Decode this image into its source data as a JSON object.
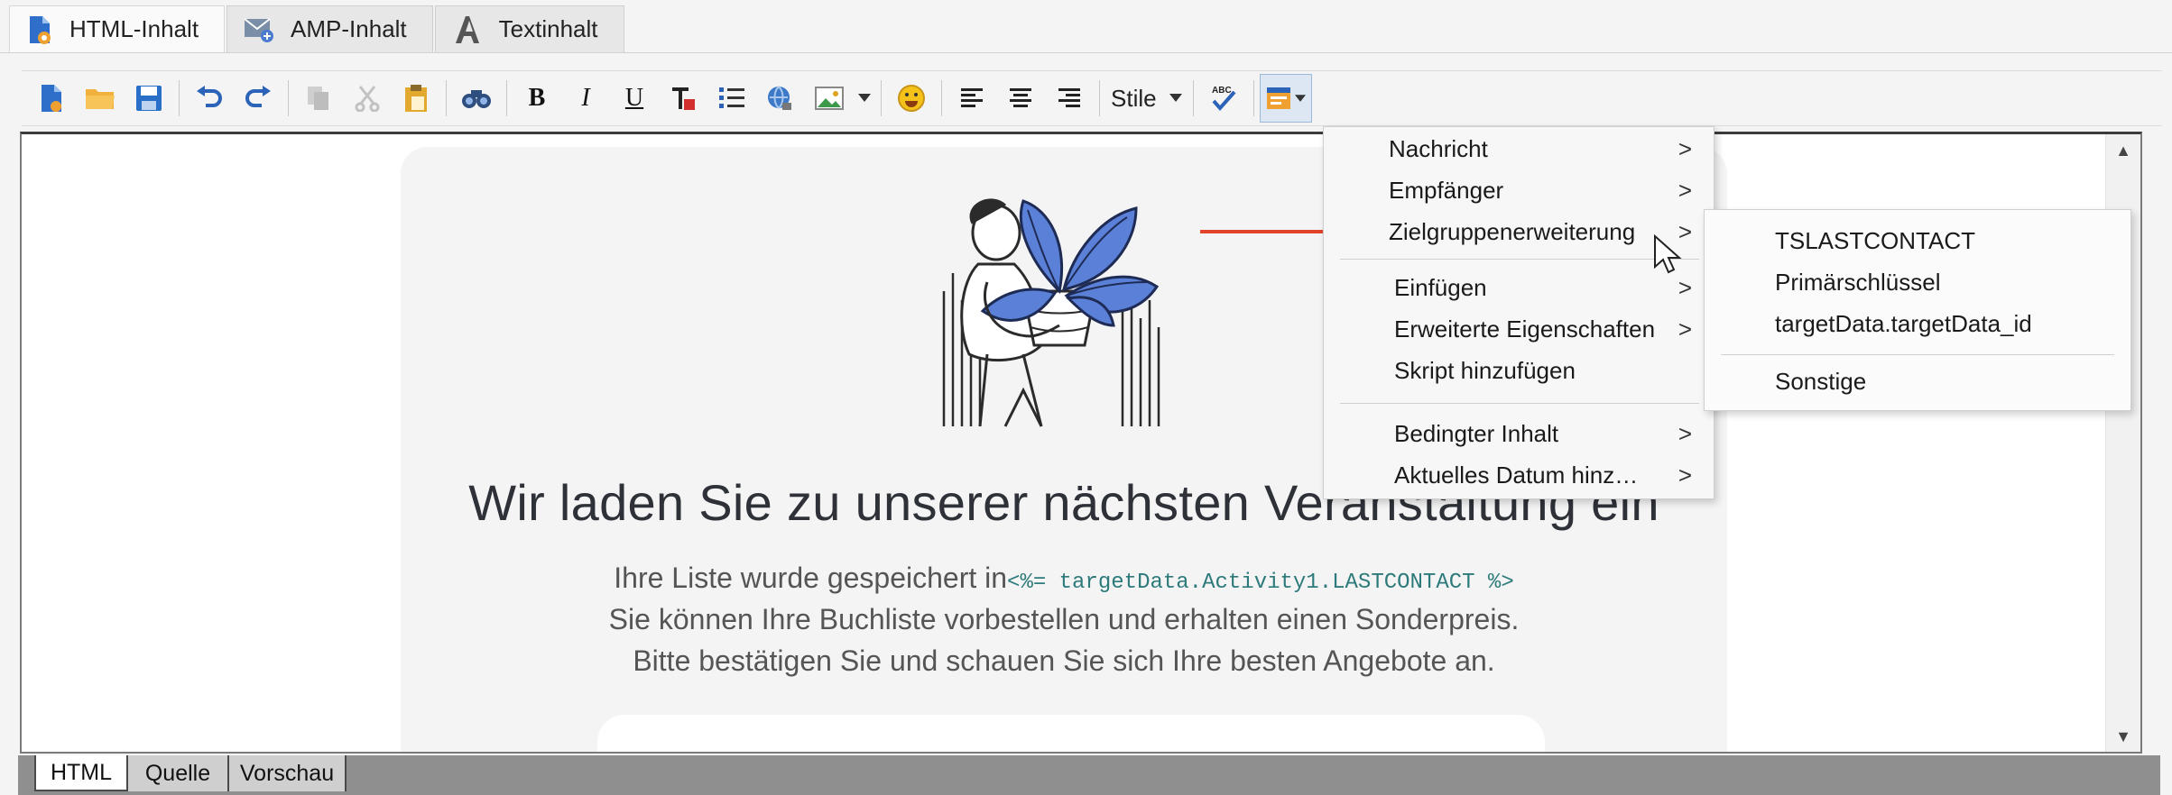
{
  "tabs": [
    {
      "label": "HTML-Inhalt",
      "icon": "html-content-icon",
      "active": true
    },
    {
      "label": "AMP-Inhalt",
      "icon": "amp-content-icon",
      "active": false
    },
    {
      "label": "Textinhalt",
      "icon": "text-content-icon",
      "active": false
    }
  ],
  "toolbar": {
    "buttons": [
      "new-document-icon",
      "open-folder-icon",
      "save-icon",
      "undo-icon",
      "redo-icon",
      "copy-icon",
      "cut-icon",
      "paste-icon",
      "find-icon",
      "bold-icon",
      "italic-icon",
      "underline-icon",
      "text-color-icon",
      "list-icon",
      "link-icon",
      "image-icon",
      "emoji-icon",
      "align-left-icon",
      "align-center-icon",
      "align-right-icon",
      "spellcheck-icon",
      "personalization-icon"
    ],
    "bold": "B",
    "italic": "I",
    "underline": "U",
    "styles_label": "Stile",
    "spellcheck_label": "ABC"
  },
  "content": {
    "headline": "Wir laden Sie zu unserer nächsten Veranstaltung ein",
    "line1_text": "Ihre Liste wurde gespeichert in",
    "line1_code": "<%= targetData.Activity1.LASTCONTACT %>",
    "line2": "Sie können Ihre Buchliste vorbestellen und erhalten einen Sonderpreis.",
    "line3": "Bitte bestätigen Sie und schauen Sie sich Ihre besten Angebote an."
  },
  "menu": {
    "items": [
      {
        "label": "Nachricht",
        "submenu": true
      },
      {
        "label": "Empfänger",
        "submenu": true
      },
      {
        "label": "Zielgruppenerweiterung",
        "submenu": true,
        "highlighted": true
      },
      {
        "label": "Einfügen",
        "submenu": true
      },
      {
        "label": "Erweiterte Eigenschaften",
        "submenu": true
      },
      {
        "label": "Skript hinzufügen",
        "submenu": false
      },
      {
        "label": "Bedingter Inhalt",
        "submenu": true
      },
      {
        "label": "Aktuelles Datum hinz…",
        "submenu": true
      }
    ],
    "chevron": ">"
  },
  "submenu": {
    "items": [
      "TSLASTCONTACT",
      "Primärschlüssel",
      "targetData.targetData_id",
      "Sonstige"
    ]
  },
  "bottom_tabs": [
    {
      "label": "HTML",
      "active": true
    },
    {
      "label": "Quelle",
      "active": false
    },
    {
      "label": "Vorschau",
      "active": false
    }
  ],
  "colors": {
    "accent_arrow": "#e0442a",
    "code_text": "#2d7a7a",
    "illustration_blue": "#5b80d8",
    "headline": "#2e3138"
  }
}
